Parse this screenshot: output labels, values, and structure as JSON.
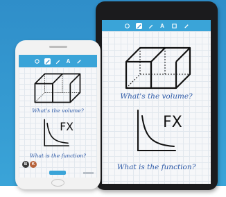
{
  "colors": {
    "background_top": "#2f8ec9",
    "background_bottom": "#3aa4d8",
    "toolbar": "#3aa4d8",
    "handwriting": "#2f5ba8"
  },
  "toolbar_icons": [
    "select-icon",
    "pen-icon",
    "highlighter-icon",
    "text-icon",
    "undo-icon"
  ],
  "toolbar_text_tool": "A",
  "tablet": {
    "question_volume": "What's the volume?",
    "question_function": "What is the function?",
    "function_label": "FX"
  },
  "phone": {
    "question_volume": "What's the volume?",
    "question_function": "What is the function?",
    "function_label": "FX",
    "avatars": [
      {
        "initial": "B",
        "color": "#3a3a3a"
      },
      {
        "initial": "K",
        "color": "#b6623a"
      }
    ]
  }
}
